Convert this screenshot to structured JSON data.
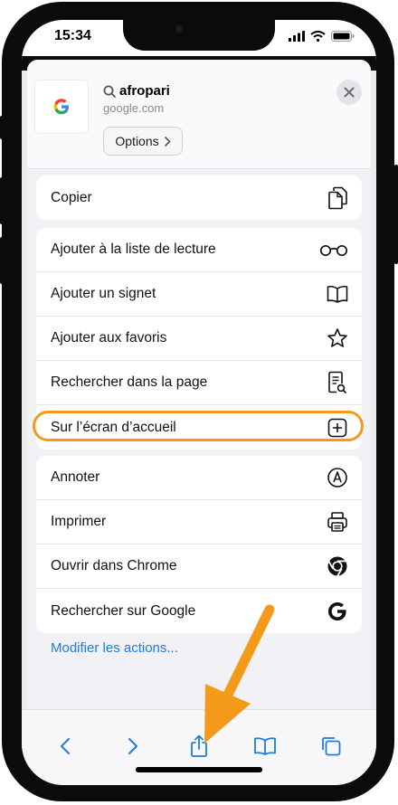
{
  "status_bar": {
    "time": "15:34"
  },
  "site": {
    "title": "afropari",
    "subtitle": "google.com",
    "options_label": "Options"
  },
  "groups": [
    {
      "items": [
        {
          "label": "Copier",
          "icon": "copy-icon"
        }
      ]
    },
    {
      "items": [
        {
          "label": "Ajouter à la liste de lecture",
          "icon": "glasses-icon"
        },
        {
          "label": "Ajouter un signet",
          "icon": "book-icon"
        },
        {
          "label": "Ajouter aux favoris",
          "icon": "star-icon"
        },
        {
          "label": "Rechercher dans la page",
          "icon": "find-in-page-icon"
        },
        {
          "label": "Sur l’écran d’accueil",
          "icon": "add-square-icon",
          "highlighted": true
        }
      ]
    },
    {
      "items": [
        {
          "label": "Annoter",
          "icon": "markup-icon"
        },
        {
          "label": "Imprimer",
          "icon": "printer-icon"
        },
        {
          "label": "Ouvrir dans Chrome",
          "icon": "chrome-icon"
        },
        {
          "label": "Rechercher sur Google",
          "icon": "google-icon"
        }
      ]
    }
  ],
  "modify_actions_label": "Modifier les actions...",
  "toolbar": [
    "back-icon",
    "forward-icon",
    "share-icon",
    "bookmarks-icon",
    "tabs-icon"
  ],
  "colors": {
    "highlight": "#f39a1b",
    "accent": "#1e7be0"
  }
}
